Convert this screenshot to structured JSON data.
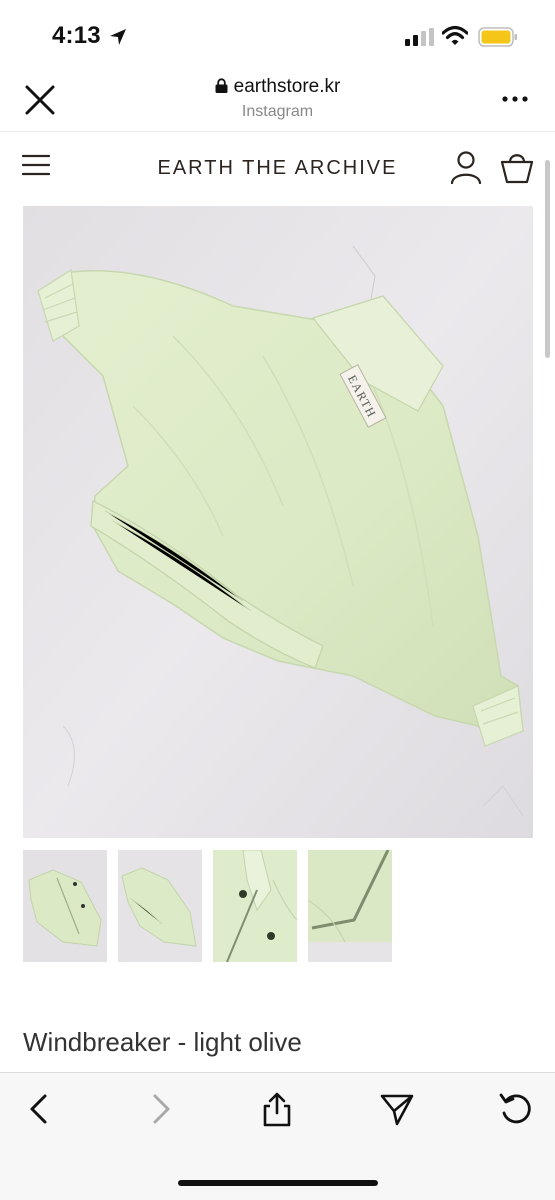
{
  "status": {
    "time": "4:13"
  },
  "browser": {
    "domain": "earthstore.kr",
    "source": "Instagram"
  },
  "site": {
    "brand": "EARTH THE ARCHIVE"
  },
  "product": {
    "title": "Windbreaker - light olive",
    "label_text": "EARTH",
    "thumbnails": [
      "thumbnail-1",
      "thumbnail-2",
      "thumbnail-3",
      "thumbnail-4"
    ]
  },
  "colors": {
    "garment": "#dfeccb",
    "background": "#e8e6e9",
    "brand_text": "#2c2420"
  },
  "toolbar": {
    "items": [
      "back",
      "forward",
      "share",
      "send",
      "reload"
    ]
  }
}
